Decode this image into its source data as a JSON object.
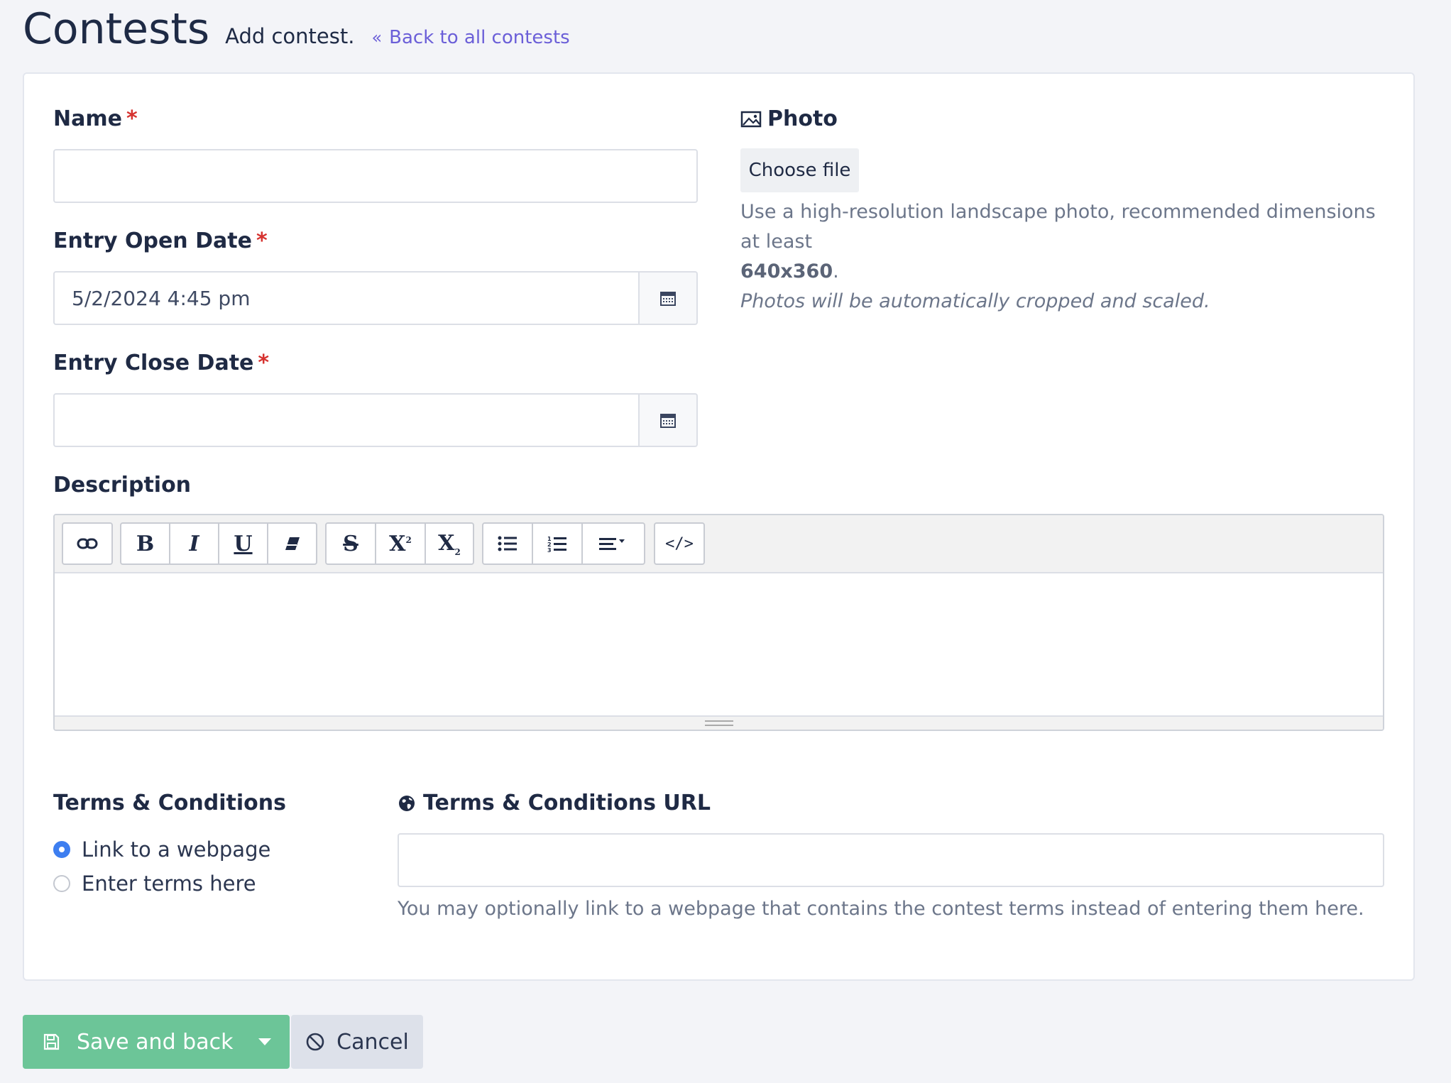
{
  "header": {
    "title": "Contests",
    "subtitle": "Add contest.",
    "back_link": "Back to all contests"
  },
  "form": {
    "name": {
      "label": "Name",
      "required_mark": "*",
      "value": ""
    },
    "entry_open_date": {
      "label": "Entry Open Date",
      "required_mark": "*",
      "value": "5/2/2024 4:45 pm"
    },
    "entry_close_date": {
      "label": "Entry Close Date",
      "required_mark": "*",
      "value": ""
    },
    "photo": {
      "label": "Photo",
      "button_label": "Choose file",
      "help_line1": "Use a high-resolution landscape photo, recommended dimensions at least",
      "help_dimensions": "640x360",
      "help_period": ".",
      "help_note": "Photos will be automatically cropped and scaled."
    },
    "description": {
      "label": "Description",
      "toolbar_icons": [
        "link-icon",
        "bold-icon",
        "italic-icon",
        "underline-icon",
        "eraser-icon",
        "strikethrough-icon",
        "superscript-icon",
        "subscript-icon",
        "unordered-list-icon",
        "ordered-list-icon",
        "align-icon",
        "code-view-icon"
      ]
    },
    "terms": {
      "label": "Terms & Conditions",
      "options": [
        "Link to a webpage",
        "Enter terms here"
      ],
      "selected": "Link to a webpage"
    },
    "terms_url": {
      "label": "Terms & Conditions URL",
      "value": "",
      "help": "You may optionally link to a webpage that contains the contest terms instead of entering them here."
    }
  },
  "actions": {
    "save_label": "Save and back",
    "cancel_label": "Cancel"
  },
  "colors": {
    "accent_link": "#6b5fd8",
    "required": "#d6322f",
    "save_button": "#6cc598",
    "radio_checked": "#3d7ef0"
  }
}
